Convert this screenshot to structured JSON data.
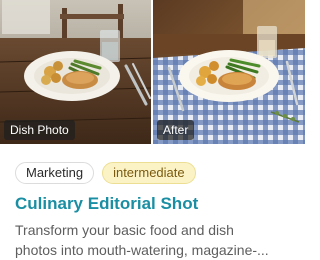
{
  "card": {
    "images": {
      "before_label": "Dish Photo",
      "after_label": "After"
    },
    "tags": {
      "category": "Marketing",
      "level": "intermediate"
    },
    "title": "Culinary Editorial Shot",
    "description_line1": "Transform your basic food and dish",
    "description_line2": "photos into mouth-watering, magazine-..."
  },
  "colors": {
    "title": "#1a8fa3",
    "level_tag_bg": "#fbf3c6",
    "level_tag_text": "#7a5a0e"
  }
}
